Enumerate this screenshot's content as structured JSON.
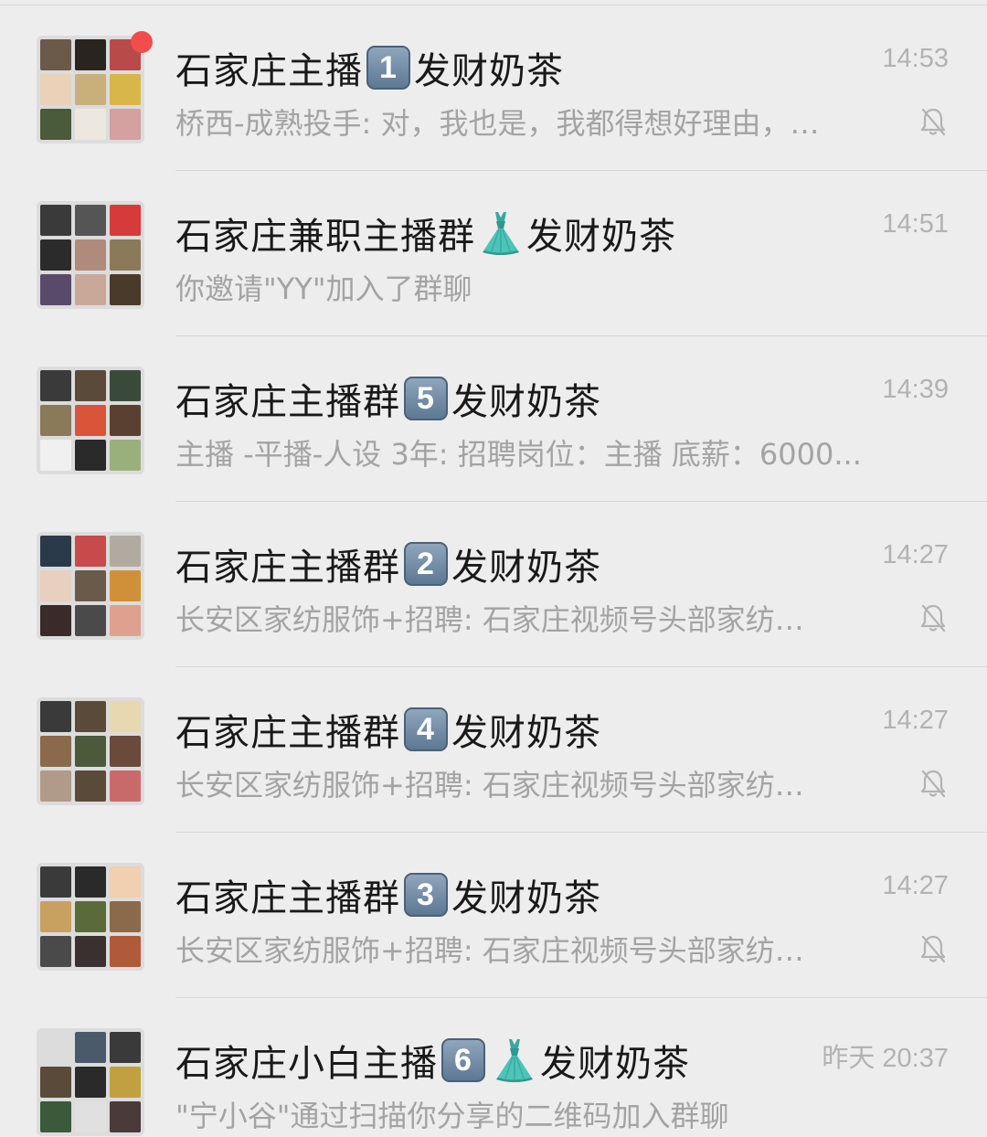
{
  "conversations": [
    {
      "title_prefix": "石家庄主播",
      "keycap": "1",
      "has_dress_emoji": false,
      "title_suffix": "发财奶茶",
      "time": "14:53",
      "preview": "桥西-成熟投手: 对，我也是，我都得想好理由，…",
      "muted": true,
      "unread_dot": true,
      "avatar_icon": "group-avatar-icon",
      "avatar_colors": [
        "#6b5a4a",
        "#2a2420",
        "#b84a4a",
        "#e9d2b8",
        "#c9b07a",
        "#d9b64a",
        "#4a5a3a",
        "#ece8e0",
        "#d4a0a0"
      ]
    },
    {
      "title_prefix": "石家庄兼职主播群",
      "keycap": "",
      "has_dress_emoji": true,
      "title_suffix": "发财奶茶",
      "time": "14:51",
      "preview": "你邀请\"YY\"加入了群聊",
      "muted": false,
      "unread_dot": false,
      "avatar_icon": "group-avatar-icon",
      "avatar_colors": [
        "#3a3a3a",
        "#555555",
        "#d63a3a",
        "#2b2b2b",
        "#b08a7a",
        "#8a7a5a",
        "#5a4a6a",
        "#c8a898",
        "#4a3a2a"
      ]
    },
    {
      "title_prefix": "石家庄主播群",
      "keycap": "5",
      "has_dress_emoji": false,
      "title_suffix": "发财奶茶",
      "time": "14:39",
      "preview": "主播 -平播-人设 3年: 招聘岗位：主播 底薪：6000...",
      "muted": false,
      "unread_dot": false,
      "avatar_icon": "group-avatar-icon",
      "avatar_colors": [
        "#3a3a3a",
        "#5a4a3a",
        "#3a4a3a",
        "#8a7a5a",
        "#d9553a",
        "#5a4030",
        "#f0f0f0",
        "#2a2a2a",
        "#9ab07a"
      ]
    },
    {
      "title_prefix": "石家庄主播群",
      "keycap": "2",
      "has_dress_emoji": false,
      "title_suffix": "发财奶茶",
      "time": "14:27",
      "preview": "长安区家纺服饰+招聘: 石家庄视频号头部家纺…",
      "muted": true,
      "unread_dot": false,
      "avatar_icon": "group-avatar-icon",
      "avatar_colors": [
        "#2a3a4a",
        "#c84a4a",
        "#b0aaa0",
        "#e8d0c0",
        "#6a5a4a",
        "#d0903a",
        "#3a2a2a",
        "#4a4a4a",
        "#e0a090"
      ]
    },
    {
      "title_prefix": "石家庄主播群",
      "keycap": "4",
      "has_dress_emoji": false,
      "title_suffix": "发财奶茶",
      "time": "14:27",
      "preview": "长安区家纺服饰+招聘: 石家庄视频号头部家纺…",
      "muted": true,
      "unread_dot": false,
      "avatar_icon": "group-avatar-icon",
      "avatar_colors": [
        "#3a3a3a",
        "#5a4a3a",
        "#e8d8b0",
        "#8a6a4a",
        "#4a5a3a",
        "#6a4a3a",
        "#b09a8a",
        "#5a4a3a",
        "#c86a6a"
      ]
    },
    {
      "title_prefix": "石家庄主播群",
      "keycap": "3",
      "has_dress_emoji": false,
      "title_suffix": "发财奶茶",
      "time": "14:27",
      "preview": "长安区家纺服饰+招聘: 石家庄视频号头部家纺…",
      "muted": true,
      "unread_dot": false,
      "avatar_icon": "group-avatar-icon",
      "avatar_colors": [
        "#3a3a3a",
        "#2a2a2a",
        "#f0d0b0",
        "#c8a060",
        "#5a6a3a",
        "#8a6a4a",
        "#4a4a4a",
        "#3a3030",
        "#b05a3a"
      ]
    },
    {
      "title_prefix": "石家庄小白主播",
      "keycap": "6",
      "has_dress_emoji": true,
      "title_suffix": "发财奶茶",
      "time": "昨天 20:37",
      "preview": "\"宁小谷\"通过扫描你分享的二维码加入群聊",
      "muted": false,
      "unread_dot": false,
      "avatar_icon": "group-avatar-icon",
      "avatar_colors": [
        "#dcdcdc",
        "#4a5a6a",
        "#3a3a3a",
        "#5a4a3a",
        "#2a2a2a",
        "#c0a040",
        "#3a5a3a",
        "#e0e0e0",
        "#4a3a3a"
      ]
    }
  ],
  "colors": {
    "background": "#ededed",
    "title": "#191919",
    "preview": "#a3a3a3",
    "time": "#b2b2b2",
    "unread_dot": "#f24c4c",
    "divider": "#d6d6d6"
  }
}
